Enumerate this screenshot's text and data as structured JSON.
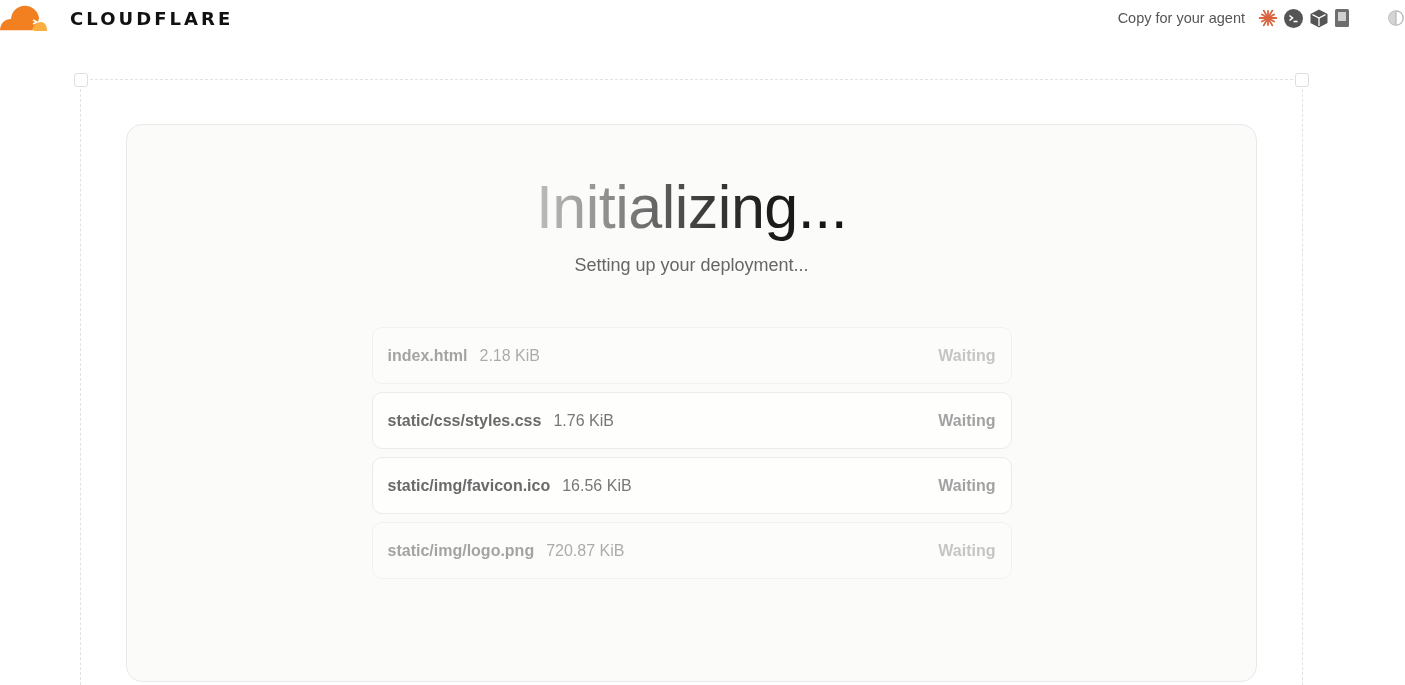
{
  "header": {
    "logo_text": "CLOUDFLARE",
    "copy_label": "Copy for your agent"
  },
  "status": {
    "title": "Initializing...",
    "subtitle": "Setting up your deployment..."
  },
  "files": [
    {
      "name": "index.html",
      "size": "2.18 KiB",
      "status": "Waiting",
      "faded": true
    },
    {
      "name": "static/css/styles.css",
      "size": "1.76 KiB",
      "status": "Waiting",
      "faded": false
    },
    {
      "name": "static/img/favicon.ico",
      "size": "16.56 KiB",
      "status": "Waiting",
      "faded": false
    },
    {
      "name": "static/img/logo.png",
      "size": "720.87 KiB",
      "status": "Waiting",
      "faded": true
    }
  ]
}
